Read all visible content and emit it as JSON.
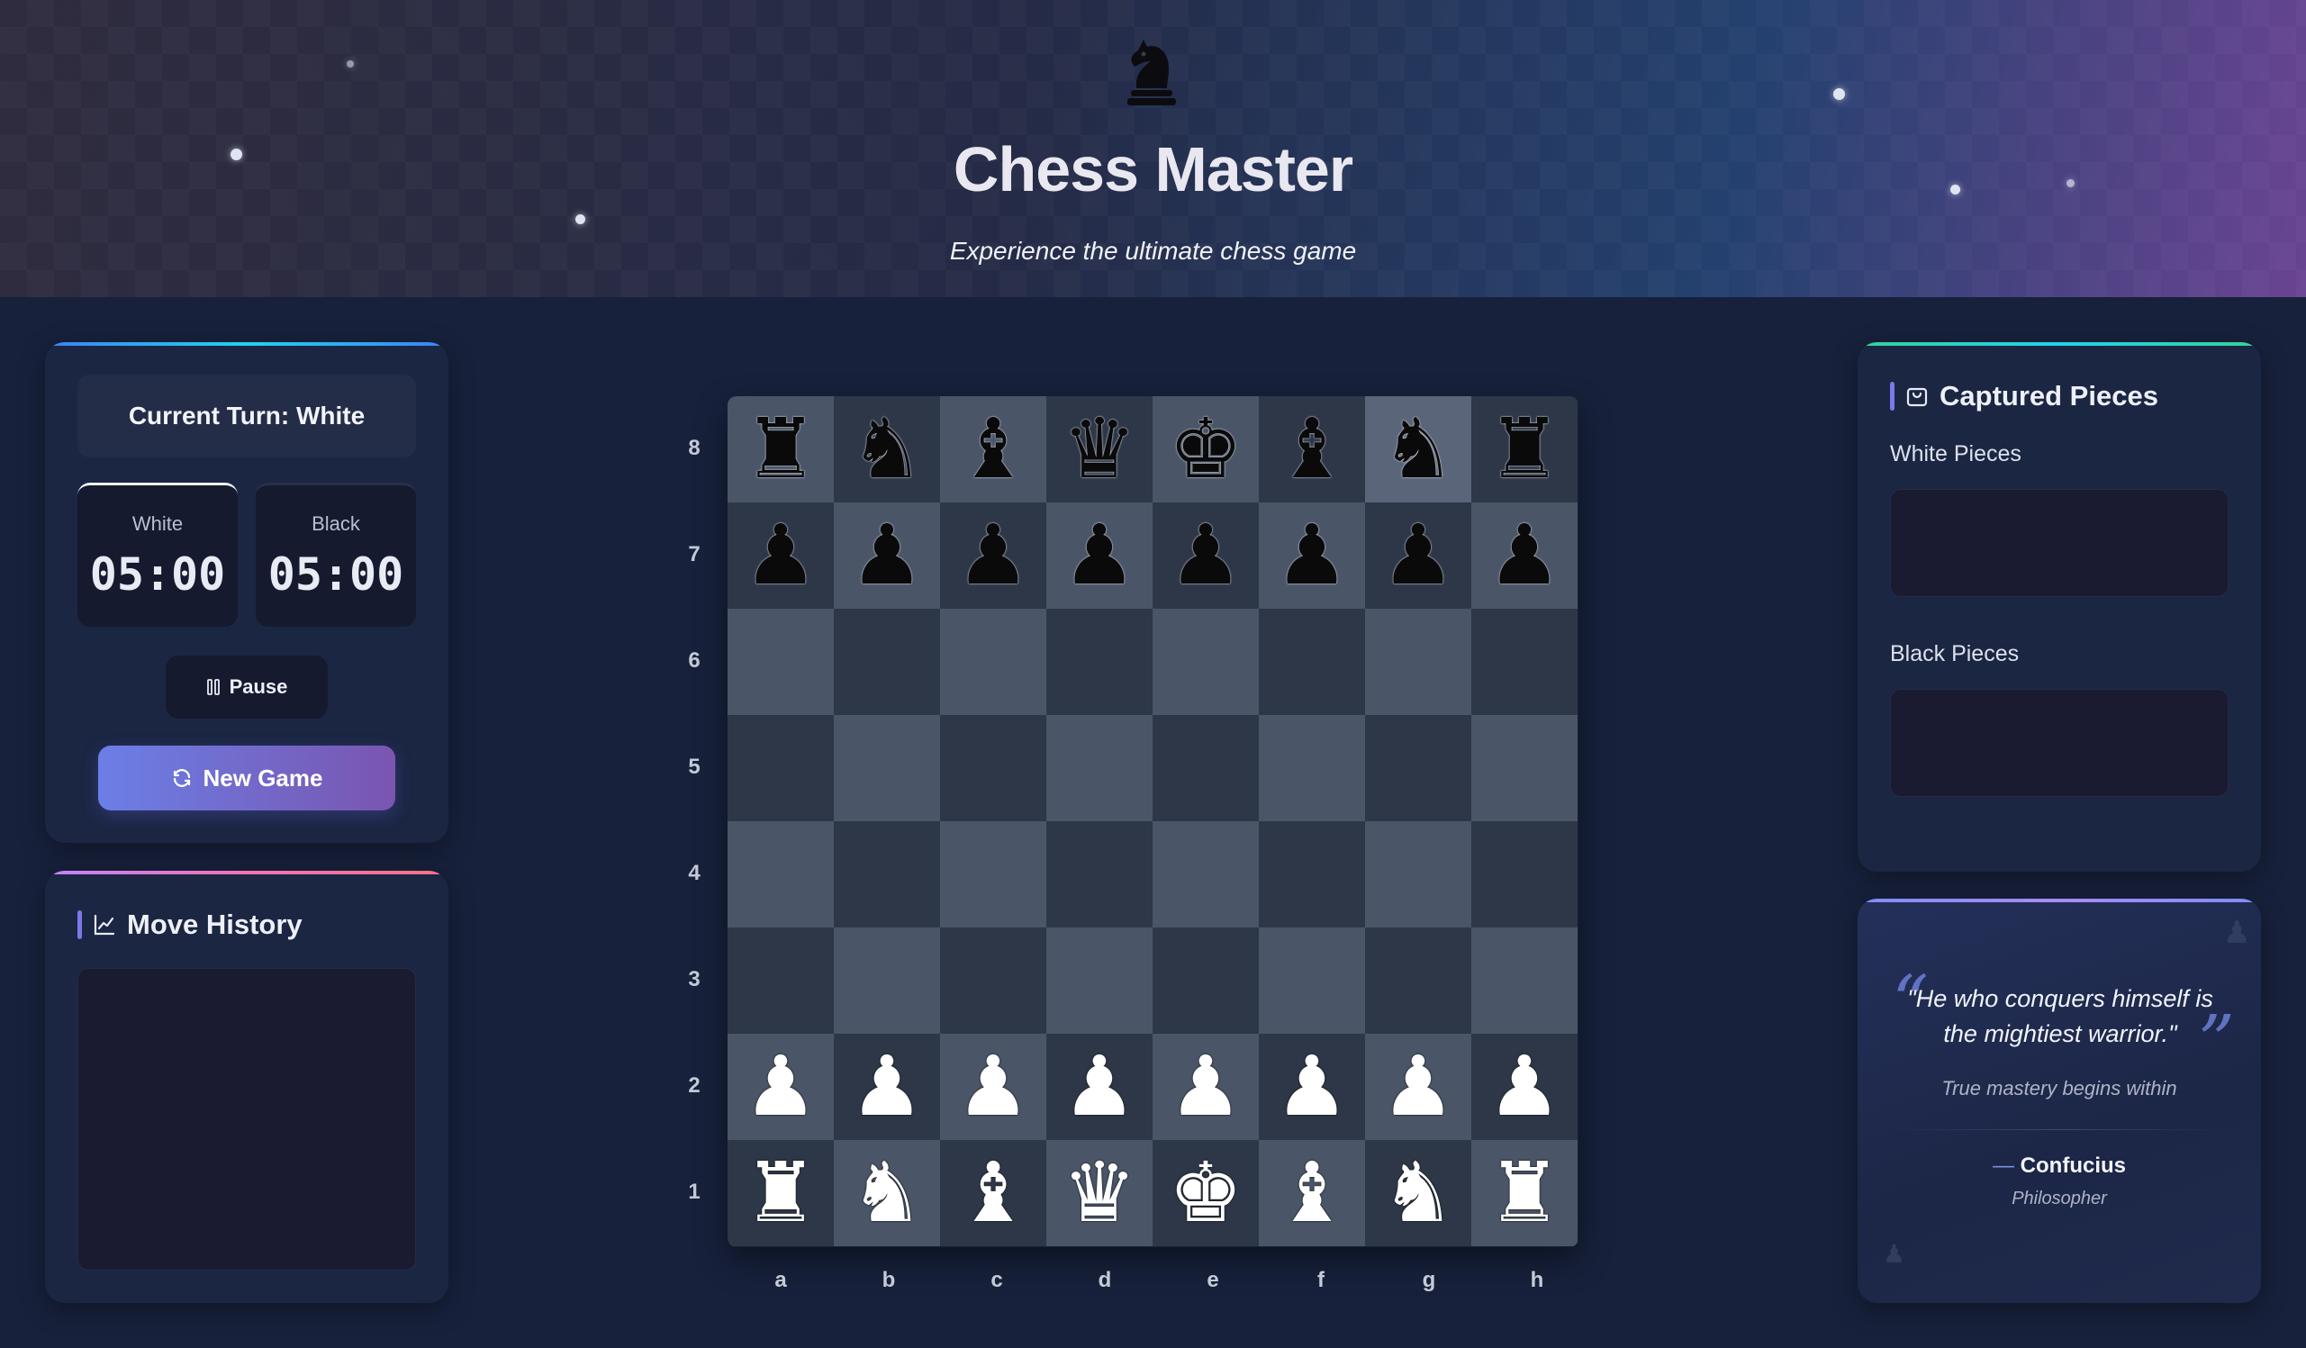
{
  "header": {
    "title": "Chess Master",
    "subtitle": "Experience the ultimate chess game",
    "logo_icon": "knight-icon"
  },
  "game_panel": {
    "turn_label": "Current Turn: White",
    "timers": [
      {
        "label": "White",
        "value": "05:00",
        "active": true
      },
      {
        "label": "Black",
        "value": "05:00",
        "active": false
      }
    ],
    "pause_label": "Pause",
    "pause_icon": "pause-icon",
    "new_game_label": "New Game",
    "new_game_icon": "refresh-icon"
  },
  "move_history": {
    "title": "Move History",
    "icon": "chart-line-icon",
    "moves": []
  },
  "captured": {
    "title": "Captured Pieces",
    "icon": "bag-icon",
    "white_label": "White Pieces",
    "black_label": "Black Pieces",
    "white_pieces": [],
    "black_pieces": []
  },
  "quote": {
    "text": "\"He who conquers himself is the mightiest warrior.\"",
    "subtext": "True mastery begins within",
    "dash": "—",
    "author": "Confucius",
    "role": "Philosopher"
  },
  "board": {
    "ranks": [
      "8",
      "7",
      "6",
      "5",
      "4",
      "3",
      "2",
      "1"
    ],
    "files": [
      "a",
      "b",
      "c",
      "d",
      "e",
      "f",
      "g",
      "h"
    ],
    "highlighted_square": "g8",
    "position": [
      [
        "bR",
        "bN",
        "bB",
        "bQ",
        "bK",
        "bB",
        "bN",
        "bR"
      ],
      [
        "bP",
        "bP",
        "bP",
        "bP",
        "bP",
        "bP",
        "bP",
        "bP"
      ],
      [
        "",
        "",
        "",
        "",
        "",
        "",
        "",
        ""
      ],
      [
        "",
        "",
        "",
        "",
        "",
        "",
        "",
        ""
      ],
      [
        "",
        "",
        "",
        "",
        "",
        "",
        "",
        ""
      ],
      [
        "",
        "",
        "",
        "",
        "",
        "",
        "",
        ""
      ],
      [
        "wP",
        "wP",
        "wP",
        "wP",
        "wP",
        "wP",
        "wP",
        "wP"
      ],
      [
        "wR",
        "wN",
        "wB",
        "wQ",
        "wK",
        "wB",
        "wN",
        "wR"
      ]
    ]
  },
  "colors": {
    "light_square": "#4a5568",
    "dark_square": "#2d3748",
    "accent": "#6b7fe6"
  }
}
